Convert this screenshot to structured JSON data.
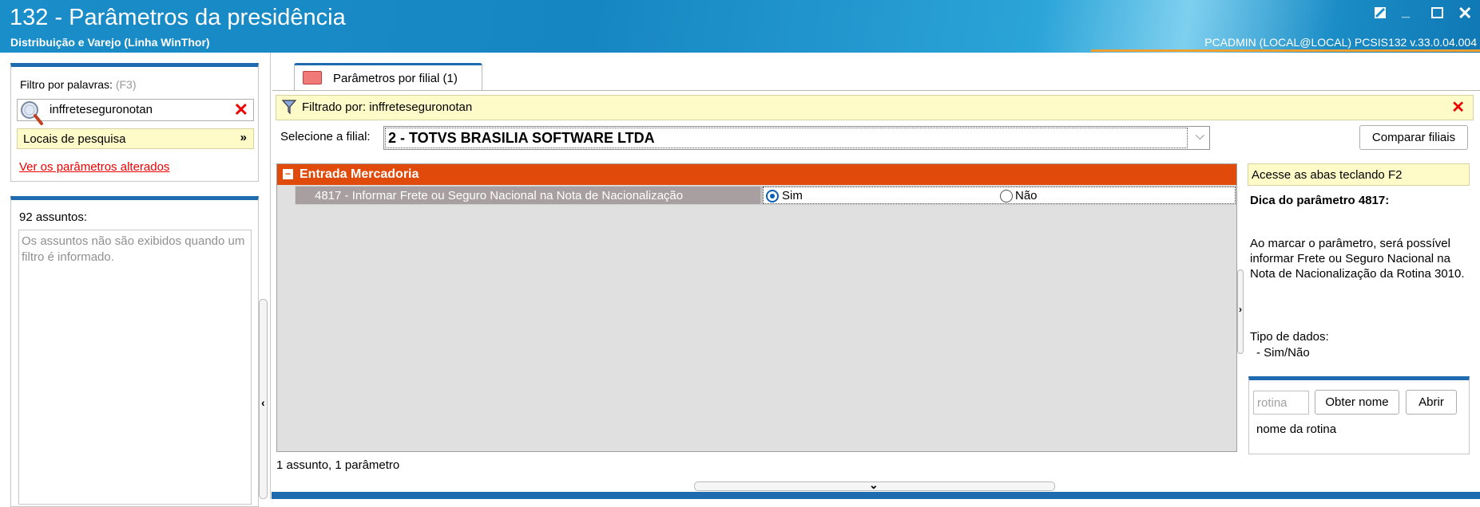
{
  "window": {
    "title": "132 - Parâmetros da presidência",
    "subtitle": "Distribuição e Varejo (Linha WinThor)",
    "user_info": "PCADMIN (LOCAL@LOCAL)   PCSIS132  v.33.0.04.004"
  },
  "left": {
    "filter_label": "Filtro por palavras:",
    "filter_hint": "(F3)",
    "search_value": "inffreteseguronotan",
    "locais_label": "Locais de pesquisa",
    "changed_link": "Ver os parâmetros alterados",
    "assuntos_label": "92 assuntos:",
    "assuntos_message": "Os assuntos não são exibidos quando um filtro é informado."
  },
  "tab": {
    "label": "Parâmetros por filial  (1)"
  },
  "filter_bar": {
    "text": "Filtrado por: inffreteseguronotan"
  },
  "filial": {
    "label": "Selecione a filial:",
    "value": "2 - TOTVS BRASILIA SOFTWARE LTDA",
    "compare_button": "Comparar filiais"
  },
  "grid": {
    "group": "Entrada Mercadoria",
    "param_label": "4817 - Informar Frete ou Seguro Nacional na Nota de Nacionalização",
    "options": [
      {
        "label": "Sim",
        "selected": true
      },
      {
        "label": "Não",
        "selected": false
      }
    ]
  },
  "status": "1 assunto, 1 parâmetro",
  "right": {
    "hint": "Acesse as abas teclando F2",
    "dica_title": "Dica do parâmetro 4817:",
    "dica_text": "Ao marcar o parâmetro, será possível informar Frete ou Seguro Nacional na Nota de Nacionalização da Rotina 3010.",
    "tipo_label": "Tipo de dados:",
    "tipo_value": "- Sim/Não",
    "rotina_placeholder": "rotina",
    "obter_button": "Obter nome",
    "abrir_button": "Abrir",
    "rotina_name": "nome da rotina"
  },
  "colors": {
    "accent": "#1e6bb0",
    "group_row": "#e04a0a",
    "highlight": "#fffbc8",
    "danger": "#e00000"
  }
}
